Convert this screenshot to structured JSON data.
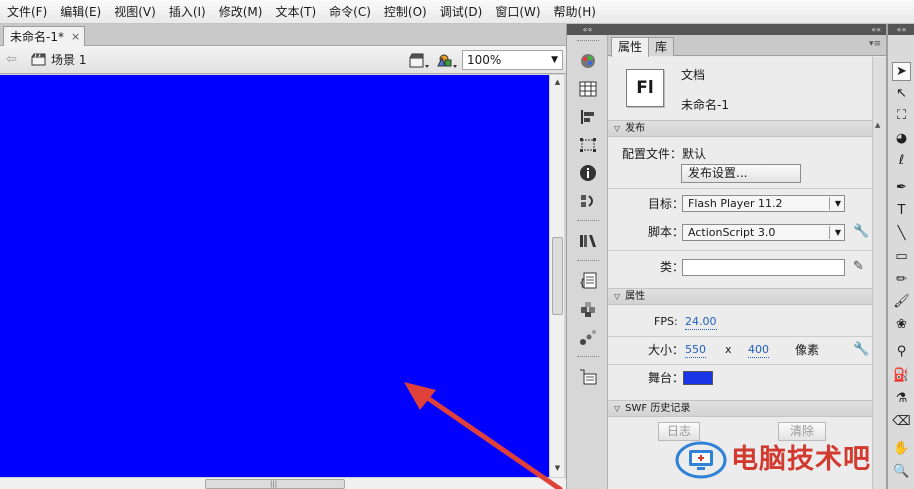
{
  "menu": [
    "文件(F)",
    "编辑(E)",
    "视图(V)",
    "插入(I)",
    "修改(M)",
    "文本(T)",
    "命令(C)",
    "控制(O)",
    "调试(D)",
    "窗口(W)",
    "帮助(H)"
  ],
  "document_tab": {
    "title": "未命名-1*",
    "close": "×"
  },
  "edit_bar": {
    "scene_label": "场景 1",
    "zoom": "100%"
  },
  "stage": {
    "color": "#0000fe"
  },
  "panel_header_glyph": "««",
  "properties": {
    "tabs": [
      "属性",
      "库"
    ],
    "doc_icon_text": "Fl",
    "doc_type": "文档",
    "doc_name": "未命名-1",
    "publish": {
      "header": "发布",
      "profile_label": "配置文件：",
      "profile_value": "默认",
      "settings_button": "发布设置...",
      "target_label": "目标：",
      "target_value": "Flash Player 11.2",
      "script_label": "脚本：",
      "script_value": "ActionScript 3.0",
      "class_label": "类："
    },
    "attributes": {
      "header": "属性",
      "fps_label": "FPS:",
      "fps_value": "24.00",
      "size_label": "大小：",
      "width": "550",
      "x": "x",
      "height": "400",
      "unit": "像素",
      "stage_label": "舞台："
    },
    "swf_history": {
      "header": "SWF 历史记录",
      "log_button": "日志",
      "clear_button": "清除"
    }
  },
  "watermark_text": "电脑技术吧",
  "colors": {
    "stage": "#0000fe",
    "stage_swatch": "#1a35e6",
    "watermark": "#d23a2f",
    "annotation_arrow": "#e0403a"
  }
}
